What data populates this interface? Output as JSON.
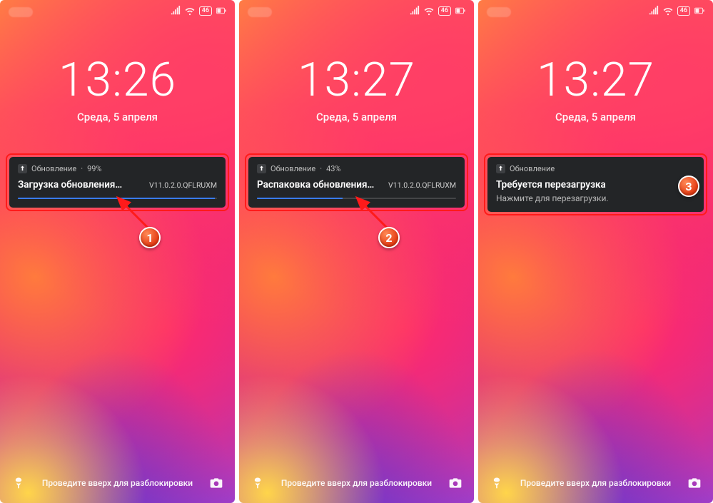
{
  "screens": [
    {
      "time": "13:26",
      "date": "Среда, 5 апреля",
      "status_battery_label": "46",
      "notif_app": "Обновление",
      "notif_separator": "·",
      "notif_percent": "99%",
      "notif_title": "Загрузка обновления…",
      "notif_version": "V11.0.2.0.QFLRUXM",
      "progress": 99,
      "has_progress": true,
      "unlock_hint": "Проведите вверх для разблокировки",
      "badge": "1"
    },
    {
      "time": "13:27",
      "date": "Среда, 5 апреля",
      "status_battery_label": "46",
      "notif_app": "Обновление",
      "notif_separator": "·",
      "notif_percent": "43%",
      "notif_title": "Распаковка обновления…",
      "notif_version": "V11.0.2.0.QFLRUXM",
      "progress": 43,
      "has_progress": true,
      "unlock_hint": "Проведите вверх для разблокировки",
      "badge": "2"
    },
    {
      "time": "13:27",
      "date": "Среда, 5 апреля",
      "status_battery_label": "46",
      "notif_app": "Обновление",
      "notif_title": "Требуется перезагрузка",
      "notif_sub": "Нажмите для перезагрузки.",
      "has_progress": false,
      "unlock_hint": "Проведите вверх для разблокировки",
      "badge": "3"
    }
  ]
}
